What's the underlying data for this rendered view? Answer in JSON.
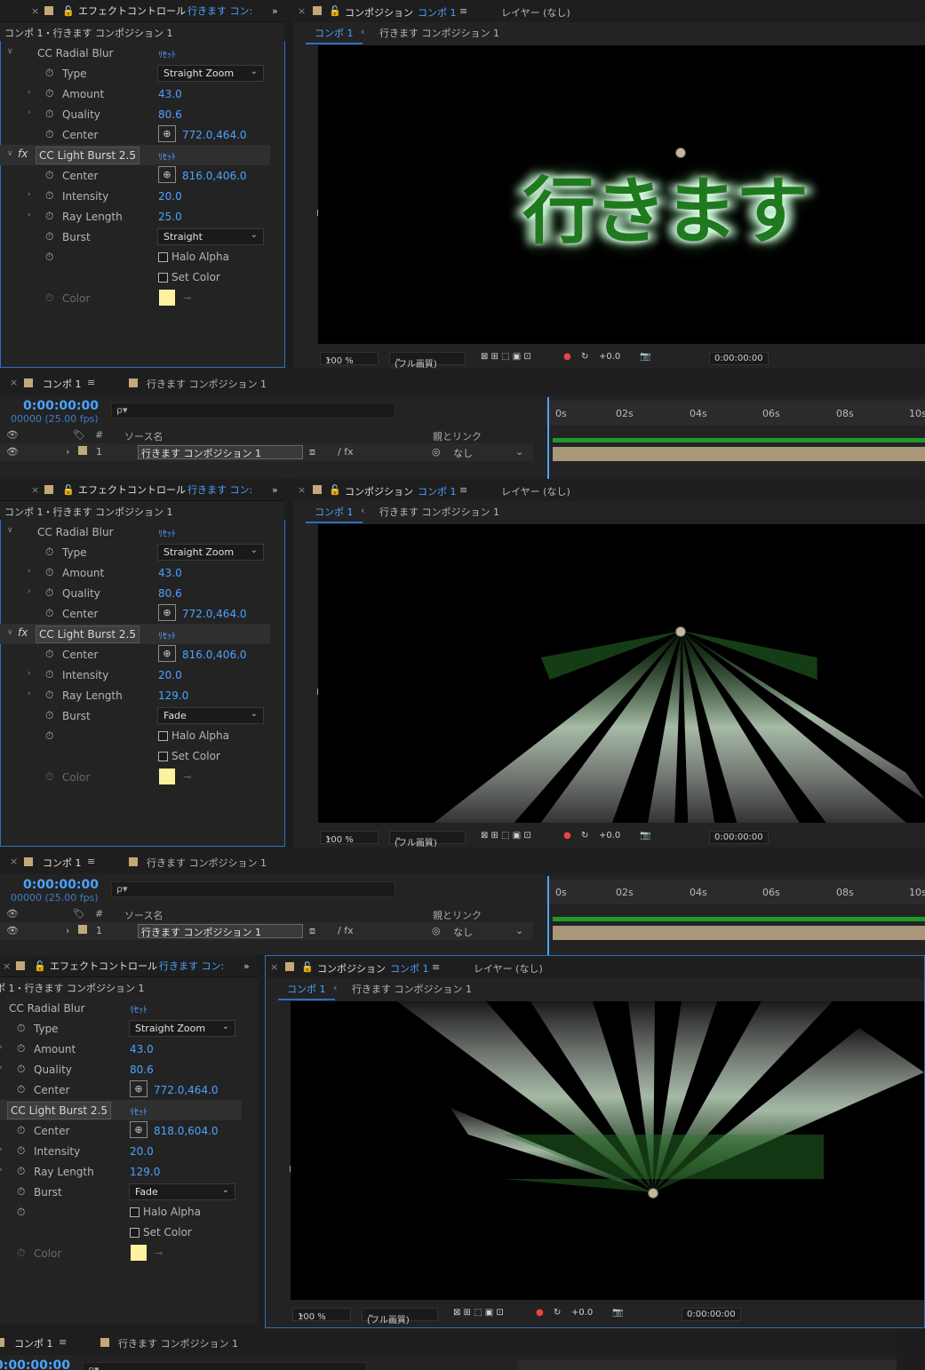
{
  "panels": {
    "effect_controls_title": "エフェクトコントロール",
    "effect_controls_layer": "行きます コン:",
    "effect_controls_subtitle": "コンポ 1・行きます コンポジション 1",
    "composition_title": "コンポジション",
    "composition_name": "コンポ 1",
    "layer_none": "レイヤー (なし)",
    "comp_tab_active": "コンポ 1",
    "comp_tab_other": "行きます コンポジション 1",
    "timeline_tab": "コンポ 1",
    "timeline_tab2": "行きます コンポジション 1"
  },
  "labels": {
    "cc_radial_blur": "CC Radial Blur",
    "cc_light_burst": "CC Light Burst 2.5",
    "reset": "ﾘｾｯﾄ",
    "type": "Type",
    "amount": "Amount",
    "quality": "Quality",
    "center": "Center",
    "intensity": "Intensity",
    "ray_length": "Ray Length",
    "burst": "Burst",
    "halo_alpha": "Halo Alpha",
    "set_color": "Set Color",
    "color": "Color",
    "fx": "fx"
  },
  "shots": [
    {
      "type": "Straight Zoom",
      "amount": "43.0",
      "quality": "80.6",
      "rb_center": "772.0,464.0",
      "lb_center": "816.0,406.0",
      "intensity": "20.0",
      "ray_length": "25.0",
      "burst": "Straight"
    },
    {
      "type": "Straight Zoom",
      "amount": "43.0",
      "quality": "80.6",
      "rb_center": "772.0,464.0",
      "lb_center": "816.0,406.0",
      "intensity": "20.0",
      "ray_length": "129.0",
      "burst": "Fade"
    },
    {
      "type": "Straight Zoom",
      "amount": "43.0",
      "quality": "80.6",
      "rb_center": "772.0,464.0",
      "lb_center": "818.0,604.0",
      "intensity": "20.0",
      "ray_length": "129.0",
      "burst": "Fade"
    }
  ],
  "canvas_text": "行きます",
  "comp_bar": {
    "zoom": "100 %",
    "quality": "(フル画質)",
    "exposure": "+0.0",
    "timecode": "0:00:00:00"
  },
  "timeline": {
    "timecode": "0:00:00:00",
    "frames": "00000 (25.00 fps)",
    "search_placeholder": "ρ▾",
    "source_name": "ソース名",
    "parent_link": "親とリンク",
    "layer_index": "1",
    "layer_name": "行きます コンポジション 1",
    "parent_value": "なし",
    "ticks": [
      "0s",
      "02s",
      "04s",
      "06s",
      "08s",
      "10s"
    ],
    "hash": "#"
  },
  "colors": {
    "accent": "#4ba3ff",
    "swatch": "#fff29e",
    "track": "#1e9a2a",
    "layer_bar": "#a9977a"
  },
  "icons": [
    "stopwatch-icon",
    "eye-icon",
    "lock-icon",
    "camera-icon",
    "target-icon",
    "chevron-down-icon"
  ]
}
